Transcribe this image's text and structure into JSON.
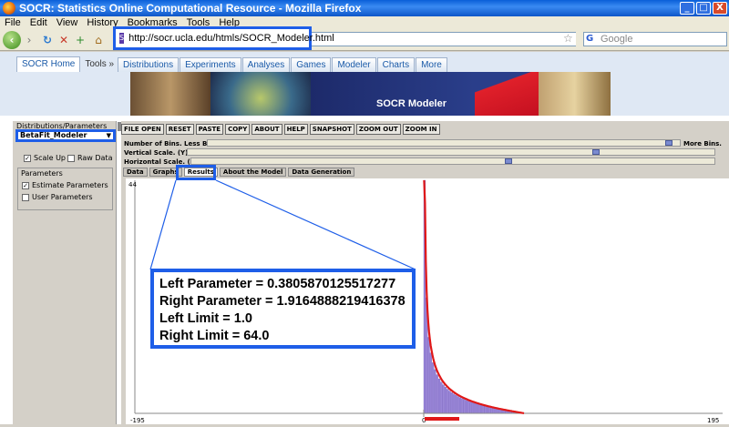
{
  "window": {
    "title": "SOCR: Statistics Online Computational Resource - Mozilla Firefox",
    "minimize": "_",
    "maximize": "□",
    "close": "X"
  },
  "menu": [
    "File",
    "Edit",
    "View",
    "History",
    "Bookmarks",
    "Tools",
    "Help"
  ],
  "nav": {
    "url": "http://socr.ucla.edu/htmls/SOCR_Modeler.html",
    "search_placeholder": "Google"
  },
  "site_tabs": {
    "home": "SOCR Home",
    "tools": "Tools »",
    "items": [
      "Distributions",
      "Experiments",
      "Analyses",
      "Games",
      "Modeler",
      "Charts",
      "More"
    ]
  },
  "banner_title": "SOCR Modeler",
  "left_panel": {
    "title": "Distributions/Parameters",
    "selected_distribution": "BetaFit_Modeler",
    "scale_up": "Scale Up",
    "raw_data": "Raw Data",
    "parameters_label": "Parameters",
    "estimate_parameters": "Estimate Parameters",
    "user_parameters": "User Parameters"
  },
  "toolbar": [
    "FILE OPEN",
    "RESET",
    "PASTE",
    "COPY",
    "ABOUT",
    "HELP",
    "SNAPSHOT",
    "ZOOM OUT",
    "ZOOM IN"
  ],
  "sliders": {
    "bins_label": "Number of Bins.  Less Bins.",
    "bins_more": "More Bins.",
    "vertical_label": "Vertical Scale. (Y)",
    "horizontal_label": "Horizontal Scale. (X)"
  },
  "subtabs": [
    "Data",
    "Graphs",
    "Results",
    "About the Model",
    "Data Generation"
  ],
  "plot": {
    "y_top_label": "44",
    "x_min_label": "-195",
    "x_zero_label": "0",
    "x_max_label": "195"
  },
  "callout": {
    "line1": "Left Parameter = 0.3805870125517277",
    "line2": "Right Parameter = 1.9164888219416378",
    "line3": "Left Limit = 1.0",
    "line4": "Right Limit = 64.0"
  },
  "colors": {
    "highlight": "#1e5ee8",
    "histogram": "#9a86d8",
    "fit_curve": "#e01818"
  }
}
